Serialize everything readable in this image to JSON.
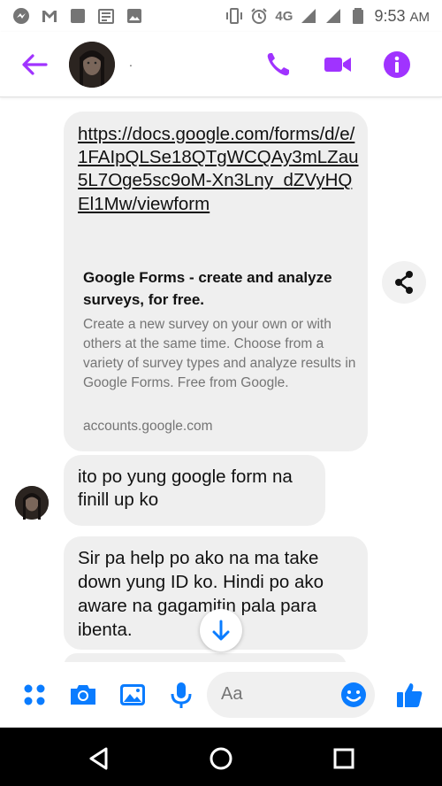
{
  "status_bar": {
    "network": "4G",
    "time": "9:53",
    "ampm": "AM",
    "icons": [
      "messenger-icon",
      "gmail-icon",
      "app-icon",
      "news-icon",
      "gallery-icon",
      "vibrate-icon",
      "alarm-icon",
      "signal-icon",
      "battery-icon"
    ]
  },
  "header": {
    "contact_name": ".",
    "icons": [
      "back-arrow-icon",
      "phone-icon",
      "video-camera-icon",
      "info-icon"
    ],
    "accent_color": "#a033ff"
  },
  "messages": {
    "link_url": "https://docs.google.com/forms/d/e/1FAIpQLSe18QTgWCQAy3mLZau5L7Oge5sc9oM-Xn3Lny_dZVyHQEl1Mw/viewform",
    "preview_title": "Google Forms - create and analyze surveys, for free.",
    "preview_description": "Create a new survey on your own or with others at the same time. Choose from a variety of survey types and analyze results in Google Forms. Free from Google.",
    "preview_domain": "accounts.google.com",
    "msg2_line1": "ito po yung google form na",
    "msg2_line2": "finill up ko",
    "msg3_line1": "Sir pa help po ako na ma take",
    "msg3_line2": "down yung ID ko. Hindi po ako",
    "msg3_line3": "aware na gagamitin pala para",
    "msg3_line4": "ibenta."
  },
  "composer": {
    "placeholder": "Aa",
    "icons": [
      "menu-dots-icon",
      "camera-icon",
      "gallery-icon",
      "microphone-icon",
      "emoji-icon",
      "thumbs-up-icon"
    ],
    "accent_color": "#0a7cff"
  },
  "nav_bar": {
    "icons": [
      "nav-back-icon",
      "nav-home-icon",
      "nav-recents-icon"
    ]
  }
}
